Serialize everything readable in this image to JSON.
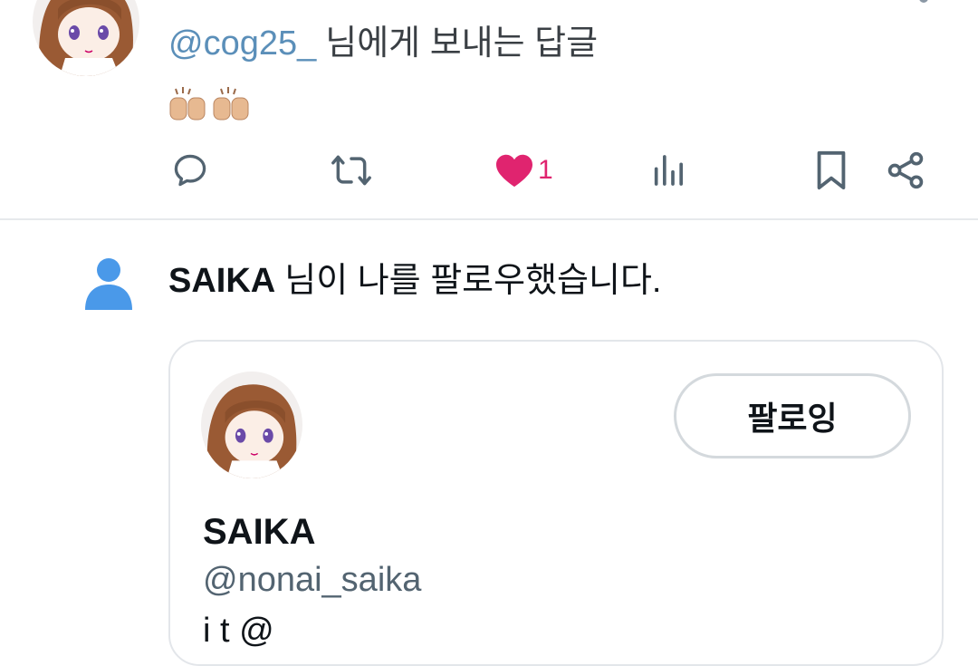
{
  "reply_tweet": {
    "reply_to_handle": "@cog25_",
    "reply_to_suffix": "님에게 보내는 답글",
    "emoji": "🙌🏼🙌🏼",
    "like_count": "1",
    "like_color": "#e0246f",
    "icons": [
      "reply-icon",
      "retweet-icon",
      "like-icon",
      "views-icon",
      "bookmark-icon",
      "share-icon"
    ]
  },
  "follow_notification": {
    "name": "SAIKA",
    "text": "님이 나를 팔로우했습니다.",
    "icon_color": "#4a99e9"
  },
  "profile_card": {
    "follow_button_label": "팔로잉",
    "display_name": "SAIKA",
    "handle": "@nonai_saika",
    "bio_partial": "i t @"
  }
}
